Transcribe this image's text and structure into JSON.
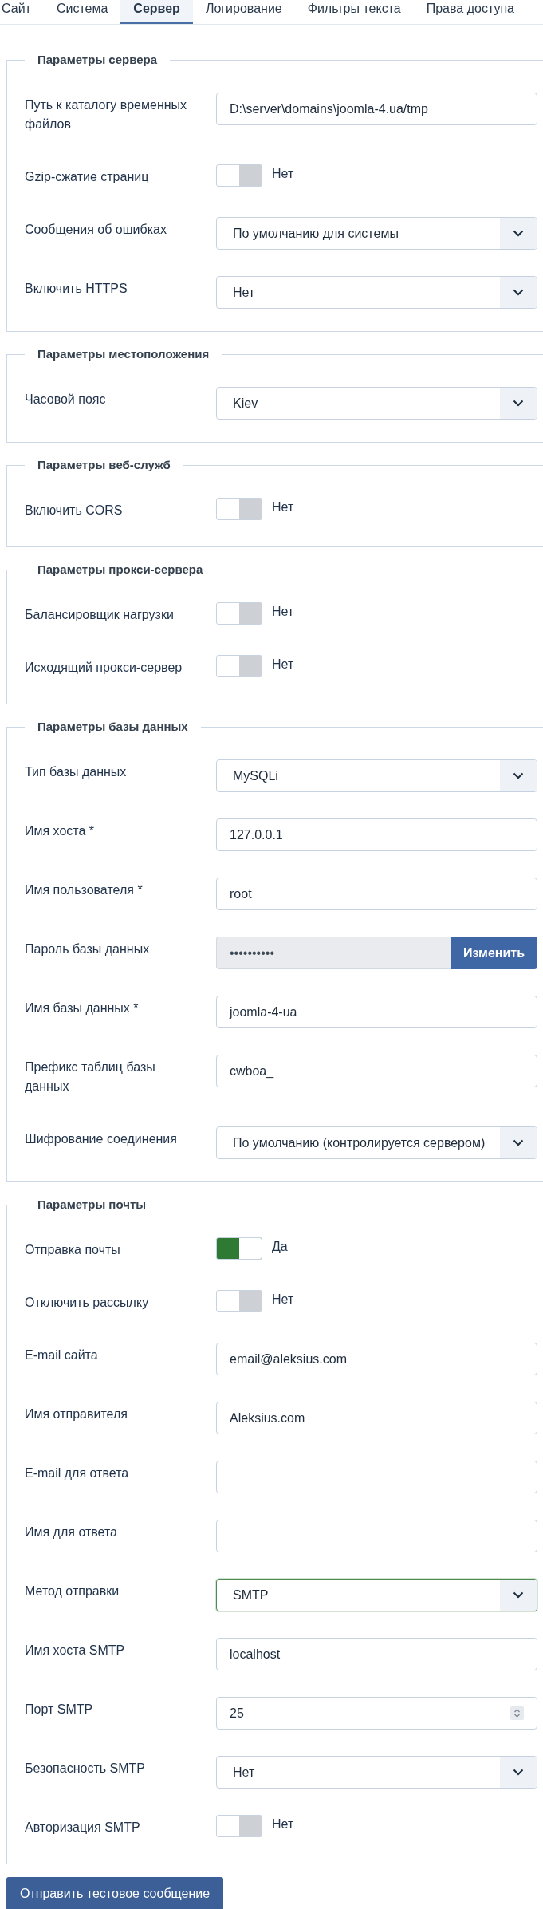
{
  "tabs": [
    {
      "label": "Сайт",
      "selected": false
    },
    {
      "label": "Система",
      "selected": false
    },
    {
      "label": "Сервер",
      "selected": true
    },
    {
      "label": "Логирование",
      "selected": false
    },
    {
      "label": "Фильтры текста",
      "selected": false
    },
    {
      "label": "Права доступа",
      "selected": false
    }
  ],
  "sections": [
    {
      "title": "Параметры сервера",
      "fields": [
        {
          "kind": "text",
          "label": "Путь к каталогу временных файлов",
          "value": "D:\\server\\domains\\joomla-4.ua/tmp"
        },
        {
          "kind": "toggle",
          "label": "Gzip-сжатие страниц",
          "on": false,
          "state_label": "Нет"
        },
        {
          "kind": "select",
          "label": "Сообщения об ошибках",
          "value": "По умолчанию для системы",
          "focused": false
        },
        {
          "kind": "select",
          "label": "Включить HTTPS",
          "value": "Нет",
          "focused": false
        }
      ]
    },
    {
      "title": "Параметры местоположения",
      "fields": [
        {
          "kind": "select",
          "label": "Часовой пояс",
          "value": "Kiev",
          "focused": false
        }
      ]
    },
    {
      "title": "Параметры веб-служб",
      "fields": [
        {
          "kind": "toggle",
          "label": "Включить CORS",
          "on": false,
          "state_label": "Нет"
        }
      ]
    },
    {
      "title": "Параметры прокси-сервера",
      "fields": [
        {
          "kind": "toggle",
          "label": "Балансировщик нагрузки",
          "on": false,
          "state_label": "Нет"
        },
        {
          "kind": "toggle",
          "label": "Исходящий прокси-сервер",
          "on": false,
          "state_label": "Нет"
        }
      ]
    },
    {
      "title": "Параметры базы данных",
      "fields": [
        {
          "kind": "select",
          "label": "Тип базы данных",
          "value": "MySQLi",
          "focused": false
        },
        {
          "kind": "text",
          "label": "Имя хоста *",
          "value": "127.0.0.1"
        },
        {
          "kind": "text",
          "label": "Имя пользователя *",
          "value": "root"
        },
        {
          "kind": "password",
          "label": "Пароль базы данных",
          "value": "••••••••••",
          "disabled": true,
          "button": "Изменить"
        },
        {
          "kind": "text",
          "label": "Имя базы данных *",
          "value": "joomla-4-ua"
        },
        {
          "kind": "text",
          "label": "Префикс таблиц базы данных",
          "value": "cwboa_"
        },
        {
          "kind": "select",
          "label": "Шифрование соединения",
          "value": "По умолчанию (контролируется сервером)",
          "focused": false
        }
      ]
    },
    {
      "title": "Параметры почты",
      "fields": [
        {
          "kind": "toggle",
          "label": "Отправка почты",
          "on": true,
          "state_label": "Да"
        },
        {
          "kind": "toggle",
          "label": "Отключить рассылку",
          "on": false,
          "state_label": "Нет"
        },
        {
          "kind": "text",
          "label": "E-mail сайта",
          "value": "email@aleksius.com"
        },
        {
          "kind": "text",
          "label": "Имя отправителя",
          "value": "Aleksius.com"
        },
        {
          "kind": "text",
          "label": "E-mail для ответа"
        },
        {
          "kind": "text",
          "label": "Имя для ответа"
        },
        {
          "kind": "select",
          "label": "Метод отправки",
          "value": "SMTP",
          "focused": true
        },
        {
          "kind": "text",
          "label": "Имя хоста SMTP",
          "value": "localhost"
        },
        {
          "kind": "number",
          "label": "Порт SMTP",
          "value": "25"
        },
        {
          "kind": "select",
          "label": "Безопасность SMTP",
          "value": "Нет",
          "focused": false
        },
        {
          "kind": "toggle",
          "label": "Авторизация SMTP",
          "on": false,
          "state_label": "Нет"
        }
      ]
    }
  ],
  "test_button": "Отправить тестовое сообщение"
}
